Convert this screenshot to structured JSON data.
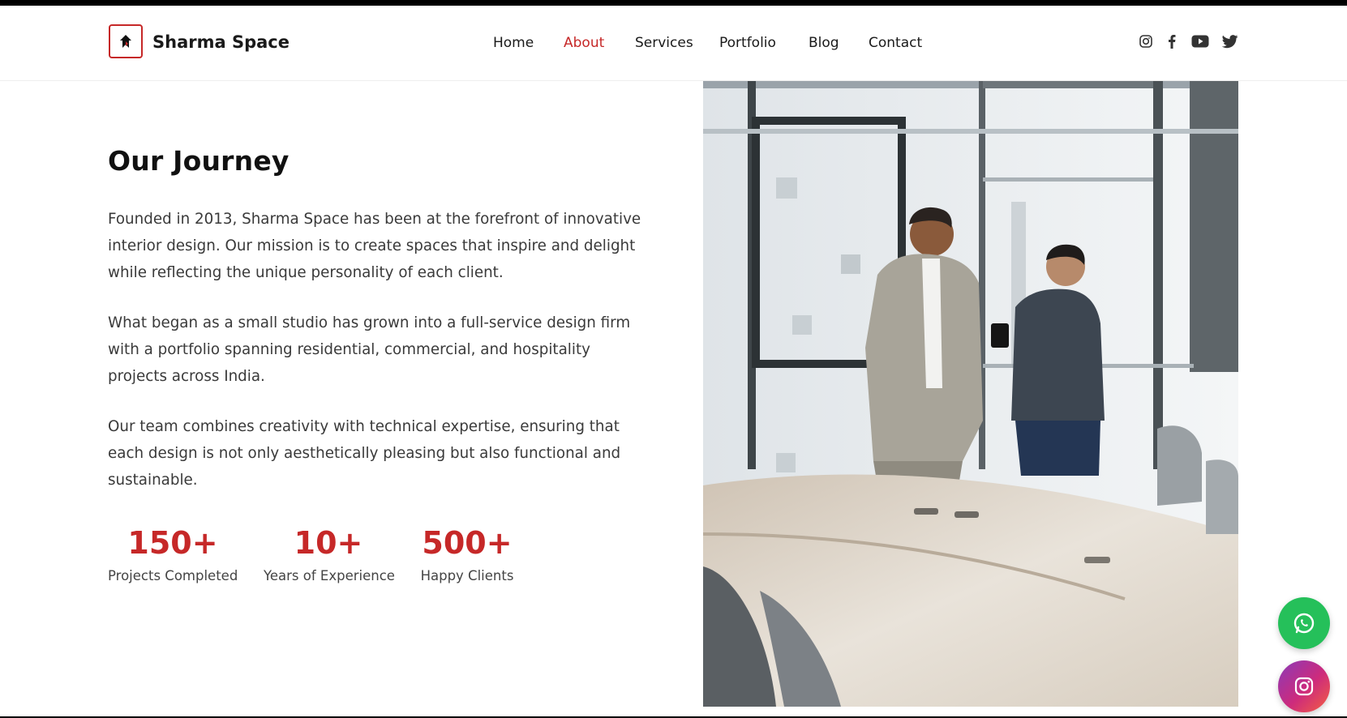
{
  "brand": {
    "name": "Sharma Space",
    "logo_icon": "house-logo-icon",
    "accent_color": "#c62828"
  },
  "nav": {
    "items": [
      {
        "label": "Home",
        "active": false
      },
      {
        "label": "About",
        "active": true
      },
      {
        "label": "Services",
        "active": false
      },
      {
        "label": "Portfolio",
        "active": false
      },
      {
        "label": "Blog",
        "active": false
      },
      {
        "label": "Contact",
        "active": false
      }
    ]
  },
  "social_links": [
    "instagram-icon",
    "facebook-icon",
    "youtube-icon",
    "twitter-icon"
  ],
  "journey": {
    "heading": "Our Journey",
    "paragraphs": [
      "Founded in 2013, Sharma Space has been at the forefront of innovative interior design. Our mission is to create spaces that inspire and delight while reflecting the unique personality of each client.",
      "What began as a small studio has grown into a full-service design firm with a portfolio spanning residential, commercial, and hospitality projects across India.",
      "Our team combines creativity with technical expertise, ensuring that each design is not only aesthetically pleasing but also functional and sustainable."
    ],
    "stats": [
      {
        "value": "150+",
        "label": "Projects Completed"
      },
      {
        "value": "10+",
        "label": "Years of Experience"
      },
      {
        "value": "500+",
        "label": "Happy Clients"
      }
    ]
  },
  "floating_buttons": [
    {
      "icon": "whatsapp-icon",
      "color": "#25c05a"
    },
    {
      "icon": "instagram-icon",
      "color": "#cd2b7c"
    }
  ]
}
